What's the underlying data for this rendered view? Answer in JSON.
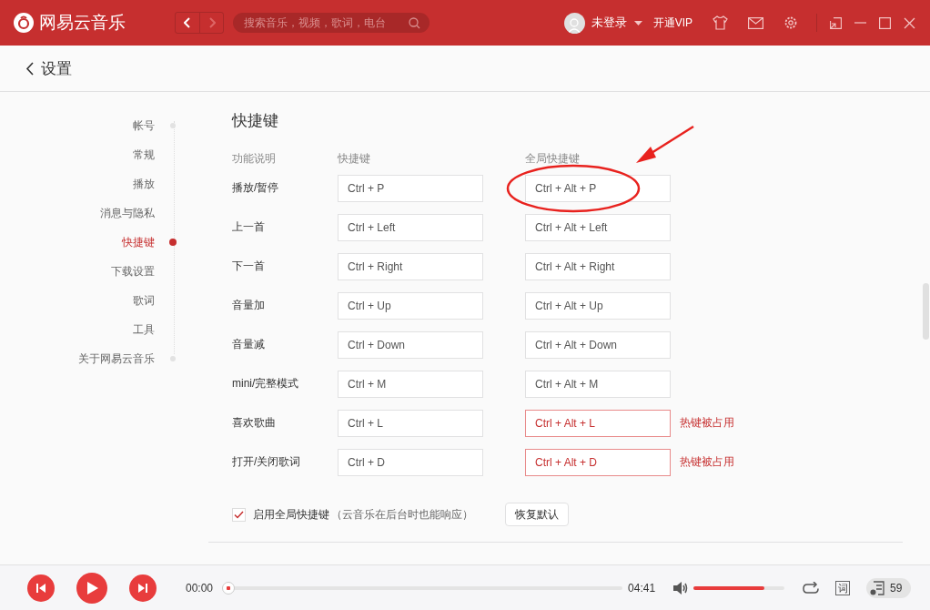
{
  "window": {
    "app_name": "网易云音乐",
    "search": {
      "placeholder": "搜索音乐，视频，歌词，电台"
    },
    "user": "未登录",
    "vip": "开通VIP"
  },
  "page": {
    "title": "设置"
  },
  "sidebar": {
    "items": [
      {
        "label": "帐号",
        "selected": false
      },
      {
        "label": "常规",
        "selected": false
      },
      {
        "label": "播放",
        "selected": false
      },
      {
        "label": "消息与隐私",
        "selected": false
      },
      {
        "label": "快捷键",
        "selected": true
      },
      {
        "label": "下载设置",
        "selected": false
      },
      {
        "label": "歌词",
        "selected": false
      },
      {
        "label": "工具",
        "selected": false
      },
      {
        "label": "关于网易云音乐",
        "selected": false
      }
    ]
  },
  "shortcuts": {
    "title": "快捷键",
    "columns": [
      "功能说明",
      "快捷键",
      "全局快捷键"
    ],
    "rows": [
      {
        "action": "播放/暂停",
        "local": "Ctrl + P",
        "global": "Ctrl + Alt + P",
        "conflict": false
      },
      {
        "action": "上一首",
        "local": "Ctrl + Left",
        "global": "Ctrl + Alt + Left",
        "conflict": false
      },
      {
        "action": "下一首",
        "local": "Ctrl + Right",
        "global": "Ctrl + Alt + Right",
        "conflict": false
      },
      {
        "action": "音量加",
        "local": "Ctrl + Up",
        "global": "Ctrl + Alt + Up",
        "conflict": false
      },
      {
        "action": "音量减",
        "local": "Ctrl + Down",
        "global": "Ctrl + Alt + Down",
        "conflict": false
      },
      {
        "action": "mini/完整模式",
        "local": "Ctrl + M",
        "global": "Ctrl + Alt + M",
        "conflict": false
      },
      {
        "action": "喜欢歌曲",
        "local": "Ctrl + L",
        "global": "Ctrl + Alt + L",
        "conflict": true,
        "conflict_note": "热键被占用"
      },
      {
        "action": "打开/关闭歌词",
        "local": "Ctrl + D",
        "global": "Ctrl + Alt + D",
        "conflict": true,
        "conflict_note": "热键被占用"
      }
    ],
    "enable_global": {
      "label": "启用全局快捷键",
      "note": "（云音乐在后台时也能响应）",
      "checked": true
    },
    "restore_button": "恢复默认"
  },
  "player": {
    "elapsed": "00:00",
    "duration": "04:41",
    "progress": {
      "level": 0
    },
    "volume": {
      "level": 0.78
    },
    "lyrics_button": "词",
    "playlist_count": "59"
  }
}
